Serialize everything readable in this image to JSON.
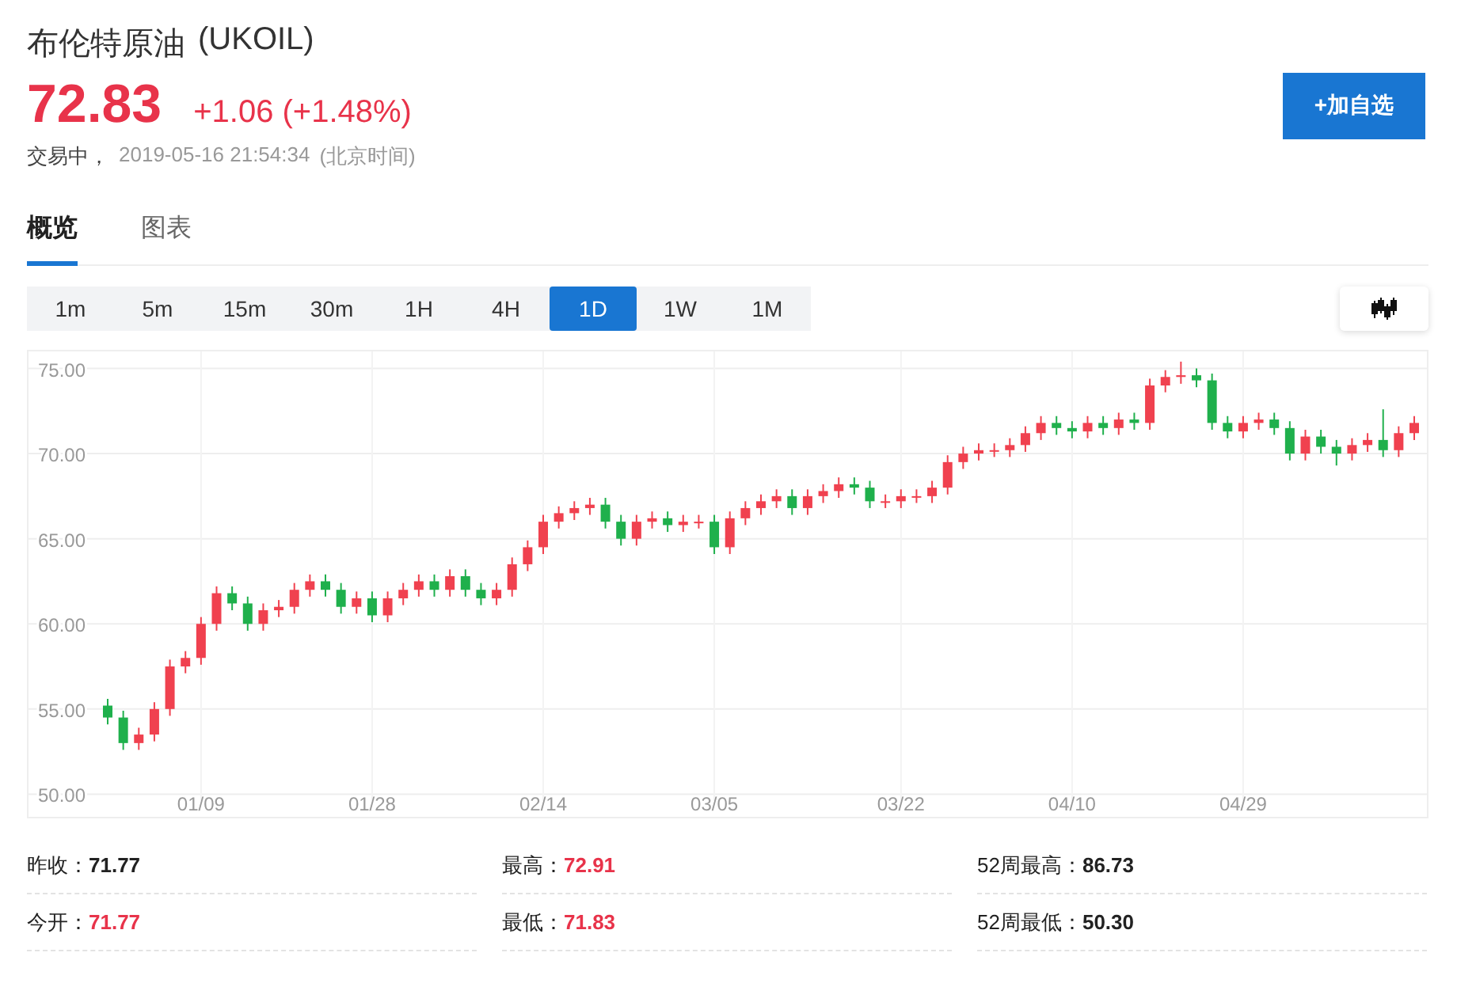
{
  "instrument": {
    "name": "布伦特原油",
    "symbol": "(UKOIL)"
  },
  "quote": {
    "price": "72.83",
    "change": "+1.06 (+1.48%)",
    "status": "交易中，",
    "time": "2019-05-16 21:54:34",
    "timezone": "(北京时间)"
  },
  "watch_button": "+加自选",
  "tabs": [
    {
      "label": "概览",
      "selected": true
    },
    {
      "label": "图表",
      "selected": false
    }
  ],
  "periods": [
    {
      "label": "1m",
      "selected": false
    },
    {
      "label": "5m",
      "selected": false
    },
    {
      "label": "15m",
      "selected": false
    },
    {
      "label": "30m",
      "selected": false
    },
    {
      "label": "1H",
      "selected": false
    },
    {
      "label": "4H",
      "selected": false
    },
    {
      "label": "1D",
      "selected": true
    },
    {
      "label": "1W",
      "selected": false
    },
    {
      "label": "1M",
      "selected": false
    }
  ],
  "chart_data": {
    "type": "candlestick",
    "ylim": [
      49.6,
      76
    ],
    "yticks": [
      {
        "value": 75,
        "label": "75.00"
      },
      {
        "value": 70,
        "label": "70.00"
      },
      {
        "value": 65,
        "label": "65.00"
      },
      {
        "value": 60,
        "label": "60.00"
      },
      {
        "value": 55,
        "label": "55.00"
      },
      {
        "value": 50,
        "label": "50.00"
      }
    ],
    "grid": true,
    "categories": [
      null,
      null,
      null,
      null,
      null,
      null,
      "01/09",
      null,
      null,
      null,
      null,
      null,
      null,
      null,
      null,
      null,
      null,
      "01/28",
      null,
      null,
      null,
      null,
      null,
      null,
      null,
      null,
      null,
      null,
      "02/14",
      null,
      null,
      null,
      null,
      null,
      null,
      null,
      null,
      null,
      null,
      "03/05",
      null,
      null,
      null,
      null,
      null,
      null,
      null,
      null,
      null,
      null,
      null,
      "03/22",
      null,
      null,
      null,
      null,
      null,
      null,
      null,
      null,
      null,
      null,
      "04/10",
      null,
      null,
      null,
      null,
      null,
      null,
      null,
      null,
      null,
      null,
      "04/29",
      null,
      null,
      null,
      null,
      null,
      null,
      null,
      null,
      null,
      null,
      null
    ],
    "ohlc": [
      [
        55.2,
        55.6,
        54.1,
        54.5
      ],
      [
        54.5,
        54.9,
        52.6,
        53
      ],
      [
        53,
        53.9,
        52.6,
        53.5
      ],
      [
        53.5,
        55.4,
        53.1,
        55
      ],
      [
        55,
        57.9,
        54.6,
        57.5
      ],
      [
        57.5,
        58.4,
        57.1,
        58
      ],
      [
        58,
        60.4,
        57.6,
        60
      ],
      [
        60,
        62.2,
        59.6,
        61.8
      ],
      [
        61.8,
        62.2,
        60.8,
        61.2
      ],
      [
        61.2,
        61.6,
        59.6,
        60
      ],
      [
        60,
        61.2,
        59.6,
        60.8
      ],
      [
        60.8,
        61.4,
        60.4,
        61
      ],
      [
        61,
        62.4,
        60.6,
        62
      ],
      [
        62,
        62.9,
        61.6,
        62.5
      ],
      [
        62.5,
        62.9,
        61.6,
        62
      ],
      [
        62,
        62.4,
        60.6,
        61
      ],
      [
        61,
        61.9,
        60.6,
        61.5
      ],
      [
        61.5,
        61.9,
        60.1,
        60.5
      ],
      [
        60.5,
        61.9,
        60.1,
        61.5
      ],
      [
        61.5,
        62.4,
        61.1,
        62
      ],
      [
        62,
        62.9,
        61.6,
        62.5
      ],
      [
        62.5,
        62.9,
        61.6,
        62
      ],
      [
        62,
        63.2,
        61.6,
        62.8
      ],
      [
        62.8,
        63.2,
        61.6,
        62
      ],
      [
        62,
        62.4,
        61.1,
        61.5
      ],
      [
        61.5,
        62.4,
        61.1,
        62
      ],
      [
        62,
        63.9,
        61.6,
        63.5
      ],
      [
        63.5,
        64.9,
        63.1,
        64.5
      ],
      [
        64.5,
        66.4,
        64.1,
        66
      ],
      [
        66,
        66.9,
        65.6,
        66.5
      ],
      [
        66.5,
        67.2,
        66.1,
        66.8
      ],
      [
        66.8,
        67.4,
        66.4,
        67
      ],
      [
        67,
        67.4,
        65.6,
        66
      ],
      [
        66,
        66.4,
        64.6,
        65
      ],
      [
        65,
        66.4,
        64.6,
        66
      ],
      [
        66,
        66.6,
        65.6,
        66.2
      ],
      [
        66.2,
        66.6,
        65.4,
        65.8
      ],
      [
        65.8,
        66.4,
        65.4,
        66
      ],
      [
        66,
        66.4,
        65.6,
        66
      ],
      [
        66,
        66.4,
        64.1,
        64.5
      ],
      [
        64.5,
        66.6,
        64.1,
        66.2
      ],
      [
        66.2,
        67.2,
        65.8,
        66.8
      ],
      [
        66.8,
        67.6,
        66.4,
        67.2
      ],
      [
        67.2,
        67.9,
        66.8,
        67.5
      ],
      [
        67.5,
        67.9,
        66.4,
        66.8
      ],
      [
        66.8,
        67.9,
        66.4,
        67.5
      ],
      [
        67.5,
        68.2,
        67.1,
        67.8
      ],
      [
        67.8,
        68.6,
        67.4,
        68.2
      ],
      [
        68.2,
        68.6,
        67.6,
        68
      ],
      [
        68,
        68.4,
        66.8,
        67.2
      ],
      [
        67.2,
        67.6,
        66.8,
        67.2
      ],
      [
        67.2,
        67.9,
        66.8,
        67.5
      ],
      [
        67.5,
        67.9,
        67.1,
        67.5
      ],
      [
        67.5,
        68.4,
        67.1,
        68
      ],
      [
        68,
        69.9,
        67.6,
        69.5
      ],
      [
        69.5,
        70.4,
        69.1,
        70
      ],
      [
        70,
        70.6,
        69.6,
        70.2
      ],
      [
        70.2,
        70.6,
        69.8,
        70.2
      ],
      [
        70.2,
        70.9,
        69.8,
        70.5
      ],
      [
        70.5,
        71.6,
        70.1,
        71.2
      ],
      [
        71.2,
        72.2,
        70.8,
        71.8
      ],
      [
        71.8,
        72.2,
        71.1,
        71.5
      ],
      [
        71.5,
        71.9,
        70.9,
        71.3
      ],
      [
        71.3,
        72.2,
        70.9,
        71.8
      ],
      [
        71.8,
        72.2,
        71.1,
        71.5
      ],
      [
        71.5,
        72.4,
        71.1,
        72
      ],
      [
        72,
        72.4,
        71.4,
        71.8
      ],
      [
        71.8,
        74.4,
        71.4,
        74
      ],
      [
        74,
        74.9,
        73.6,
        74.5
      ],
      [
        74.5,
        75.4,
        74.1,
        74.6
      ],
      [
        74.6,
        75,
        73.9,
        74.3
      ],
      [
        74.3,
        74.7,
        71.4,
        71.8
      ],
      [
        71.8,
        72.2,
        70.9,
        71.3
      ],
      [
        71.3,
        72.2,
        70.9,
        71.8
      ],
      [
        71.8,
        72.4,
        71.4,
        72
      ],
      [
        72,
        72.4,
        71.1,
        71.5
      ],
      [
        71.5,
        71.9,
        69.6,
        70
      ],
      [
        70,
        71.4,
        69.6,
        71
      ],
      [
        71,
        71.4,
        70,
        70.4
      ],
      [
        70.4,
        70.8,
        69.3,
        70
      ],
      [
        70,
        70.9,
        69.6,
        70.5
      ],
      [
        70.5,
        71.2,
        70.1,
        70.8
      ],
      [
        70.8,
        72.6,
        69.8,
        70.2
      ],
      [
        70.2,
        71.6,
        69.8,
        71.2
      ],
      [
        71.2,
        72.2,
        70.8,
        71.8
      ]
    ]
  },
  "stats": [
    {
      "label": "昨收：",
      "value": "71.77",
      "kind": "flat"
    },
    {
      "label": "最高：",
      "value": "72.91",
      "kind": "up"
    },
    {
      "label": "52周最高：",
      "value": "86.73",
      "kind": "flat"
    },
    {
      "label": "今开：",
      "value": "71.77",
      "kind": "up"
    },
    {
      "label": "最低：",
      "value": "71.83",
      "kind": "up"
    },
    {
      "label": "52周最低：",
      "value": "50.30",
      "kind": "flat"
    }
  ]
}
